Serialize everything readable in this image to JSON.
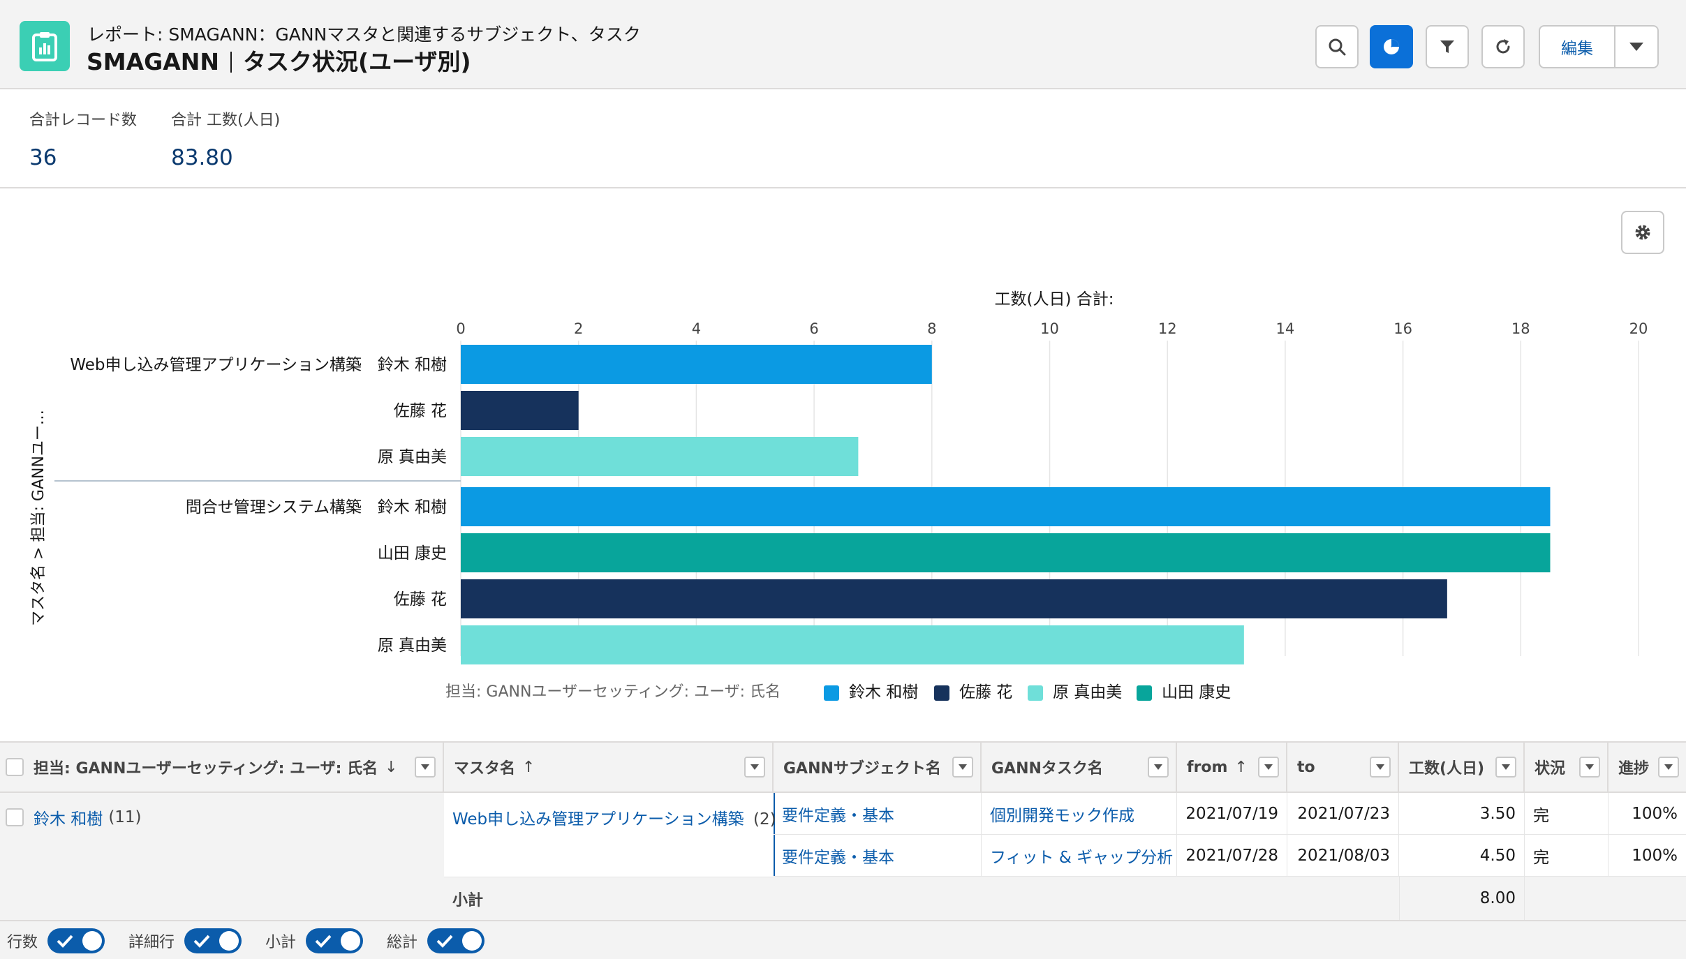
{
  "header": {
    "breadcrumb": "レポート: SMAGANN：GANNマスタと関連するサブジェクト、タスク",
    "title_left": "SMAGANN",
    "title_right": "タスク状況(ユーザ別)",
    "edit_label": "編集",
    "icons": [
      "report-icon",
      "search-icon",
      "chart-icon",
      "filter-icon",
      "refresh-icon",
      "chevron-down-icon"
    ]
  },
  "summary": {
    "records_label": "合計レコード数",
    "records_value": "36",
    "total_label": "合計 工数(人日)",
    "total_value": "83.80"
  },
  "chart_data": {
    "type": "bar",
    "orientation": "horizontal",
    "title": "工数(人日) 合計:",
    "ylabel": "マスタ名 > 担当: GANNユー…",
    "xlim": [
      0,
      20
    ],
    "xticks": [
      0,
      2,
      4,
      6,
      8,
      10,
      12,
      14,
      16,
      18,
      20
    ],
    "grid": true,
    "legend_title": "担当: GANNユーザーセッティング: ユーザ: 氏名",
    "legend_position": "bottom",
    "series": [
      {
        "name": "鈴木 和樹",
        "color": "#0b9ae3"
      },
      {
        "name": "佐藤 花",
        "color": "#16325c"
      },
      {
        "name": "原 真由美",
        "color": "#6fdfd9"
      },
      {
        "name": "山田 康史",
        "color": "#08a59b"
      }
    ],
    "groups": [
      {
        "label": "Web申し込み管理アプリケーション構築",
        "bars": [
          {
            "name": "鈴木 和樹",
            "value": 8.0
          },
          {
            "name": "佐藤 花",
            "value": 2.0
          },
          {
            "name": "原 真由美",
            "value": 6.75
          }
        ]
      },
      {
        "label": "問合せ管理システム構築",
        "bars": [
          {
            "name": "鈴木 和樹",
            "value": 18.5
          },
          {
            "name": "山田 康史",
            "value": 18.5
          },
          {
            "name": "佐藤 花",
            "value": 16.75
          },
          {
            "name": "原 真由美",
            "value": 13.3
          }
        ]
      }
    ]
  },
  "table": {
    "columns": [
      {
        "label": "担当: GANNユーザーセッティング: ユーザ: 氏名",
        "sort": "↓"
      },
      {
        "label": "マスタ名",
        "sort": "↑"
      },
      {
        "label": "GANNサブジェクト名",
        "sort": ""
      },
      {
        "label": "GANNタスク名",
        "sort": ""
      },
      {
        "label": "from",
        "sort": "↑"
      },
      {
        "label": "to",
        "sort": ""
      },
      {
        "label": "工数(人日)",
        "sort": ""
      },
      {
        "label": "状況",
        "sort": ""
      },
      {
        "label": "進捗",
        "sort": ""
      }
    ],
    "group_user": "鈴木 和樹",
    "group_user_count": "(11)",
    "group_master": "Web申し込み管理アプリケーション構築",
    "group_master_count": "(2)",
    "rows": [
      {
        "subject": "要件定義・基本",
        "task": "個別開発モック作成",
        "from": "2021/07/19",
        "to": "2021/07/23",
        "effort": "3.50",
        "status": "完",
        "progress": "100%"
      },
      {
        "subject": "要件定義・基本",
        "task": "フィット & ギャップ分析",
        "from": "2021/07/28",
        "to": "2021/08/03",
        "effort": "4.50",
        "status": "完",
        "progress": "100%"
      }
    ],
    "subtotal_label": "小計",
    "subtotal_value": "8.00"
  },
  "footer": {
    "toggles": [
      {
        "label": "行数",
        "on": true
      },
      {
        "label": "詳細行",
        "on": true
      },
      {
        "label": "小計",
        "on": true
      },
      {
        "label": "総計",
        "on": true
      }
    ]
  }
}
